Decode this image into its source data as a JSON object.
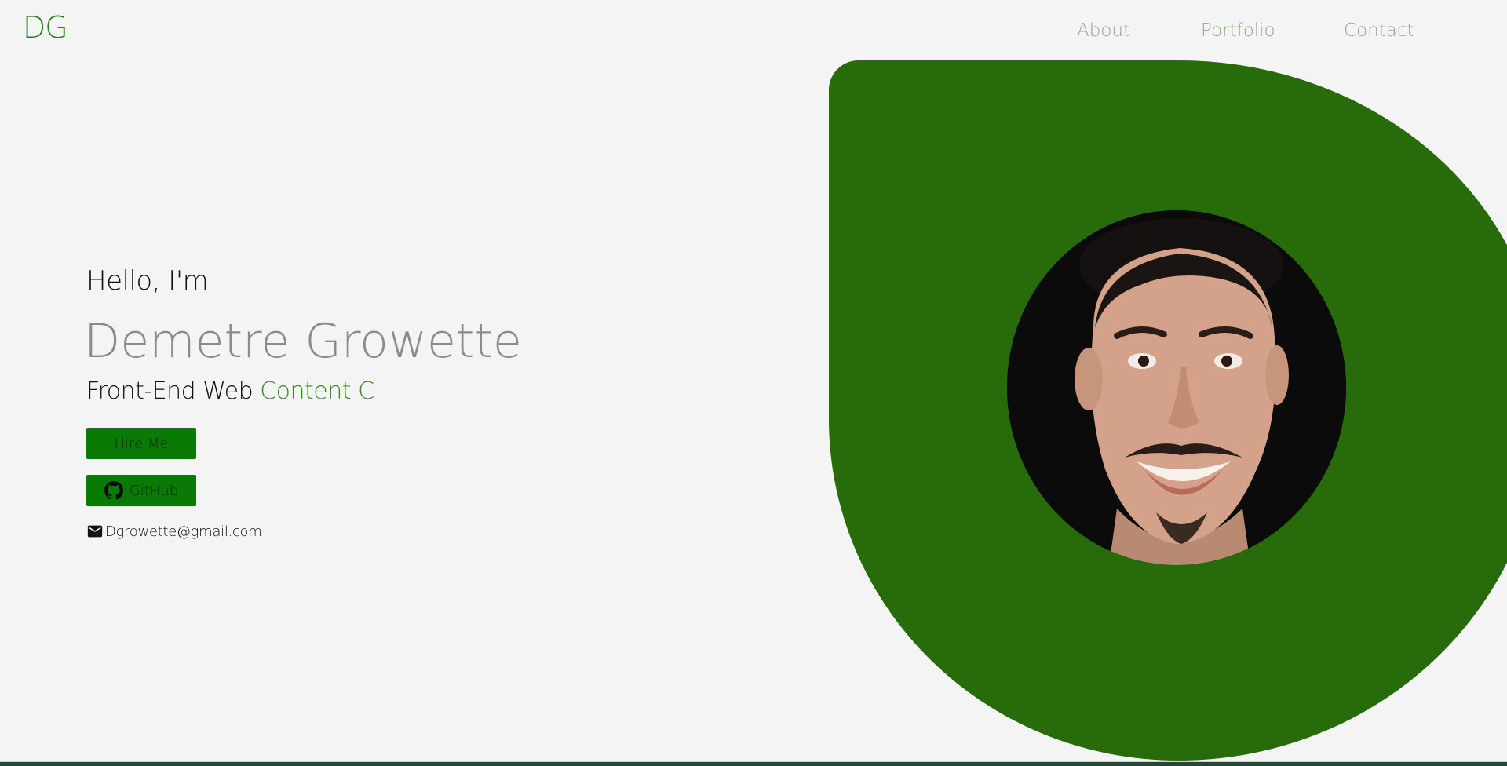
{
  "header": {
    "logo": "DG",
    "nav": [
      {
        "label": "About"
      },
      {
        "label": "Portfolio"
      },
      {
        "label": "Contact"
      }
    ]
  },
  "intro": {
    "greeting": "Hello, I'm",
    "name": "Demetre Growette",
    "role_prefix": "Front-End Web",
    "role_accent": "Content C"
  },
  "actions": {
    "hire_label": "Hire Me",
    "github_label": "GitHub"
  },
  "contact": {
    "email": "Dgrowette@gmail.com"
  },
  "icons": {
    "github": "github-icon",
    "email": "mail-icon"
  },
  "colors": {
    "brand_green": "#276b0a",
    "button_green": "#0a7a06",
    "accent_text": "#3a8e1f",
    "nav_text": "#8eae86",
    "background": "#f4f4f4"
  }
}
